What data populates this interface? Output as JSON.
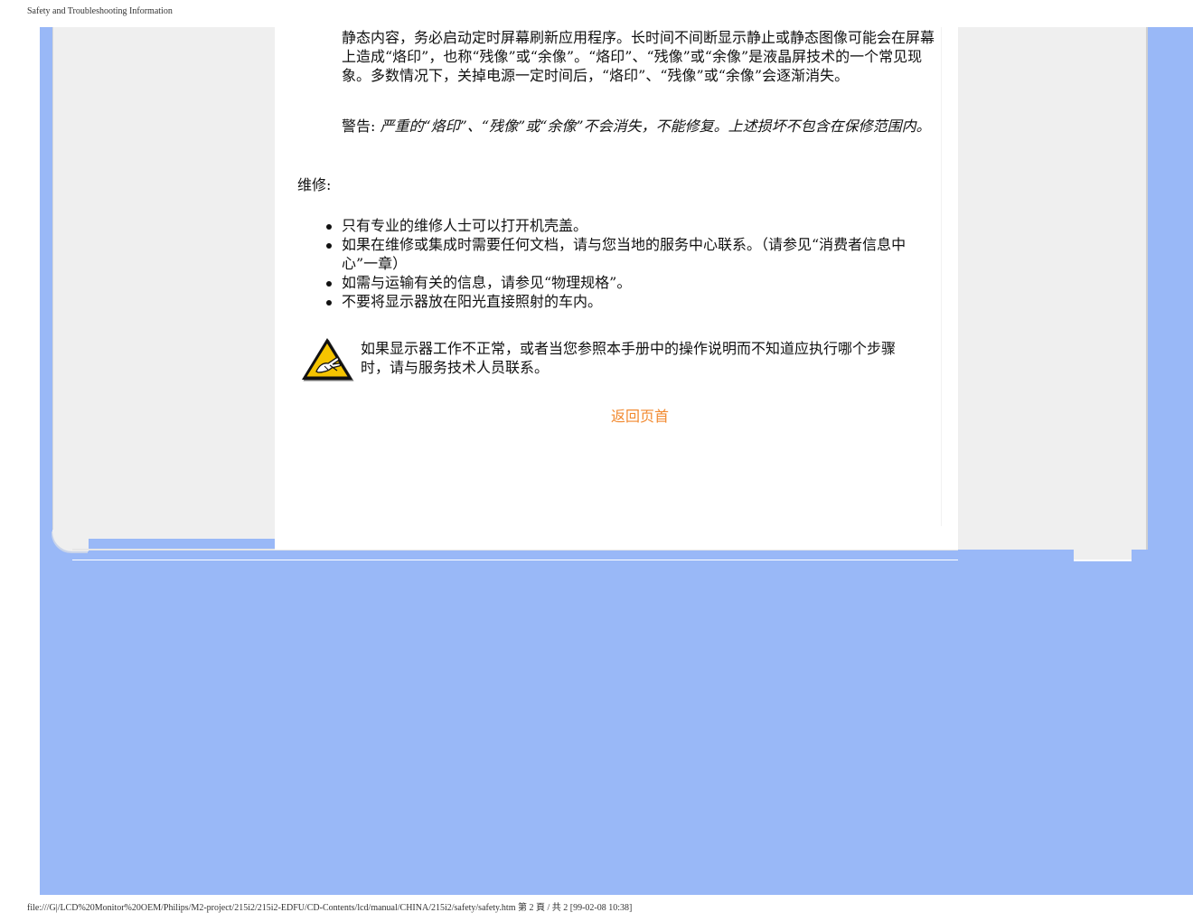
{
  "print_header": "Safety and Troubleshooting Information",
  "print_footer": "file:///G|/LCD%20Monitor%20OEM/Philips/M2-project/215i2/215i2-EDFU/CD-Contents/lcd/manual/CHINA/215i2/safety/safety.htm 第 2 頁 / 共 2  [99-02-08 10:38]",
  "content": {
    "intro_paragraph": "静态内容，务必启动定时屏幕刷新应用程序。长时间不间断显示静止或静态图像可能会在屏幕上造成“烙印”，也称“残像”或“余像”。“烙印”、“残像”或“余像”是液晶屏技术的一个常见现象。多数情况下，关掉电源一定时间后，“烙印”、“残像”或“余像”会逐渐消失。",
    "warning_label": "警告: ",
    "warning_text": "严重的“烙印”、“残像”或“余像”不会消失，不能修复。上述损坏不包含在保修范围内。",
    "service_title": "维修:",
    "service_items": [
      "只有专业的维修人士可以打开机壳盖。",
      "如果在维修或集成时需要任何文档，请与您当地的服务中心联系。（请参见“消费者信息中心”一章）",
      "如需与运输有关的信息，请参见“物理规格”。",
      "不要将显示器放在阳光直接照射的车内。"
    ],
    "notice_icon": "warning-triangle-hand-icon",
    "notice_text": "如果显示器工作不正常，或者当您参照本手册中的操作说明而不知道应执行哪个步骤时，请与服务技术人员联系。",
    "back_to_top": "返回页首"
  },
  "colors": {
    "background_blue": "#99b8f7",
    "frame_gray": "#efefef",
    "link_orange": "#f28a30",
    "icon_yellow": "#f5c400"
  }
}
